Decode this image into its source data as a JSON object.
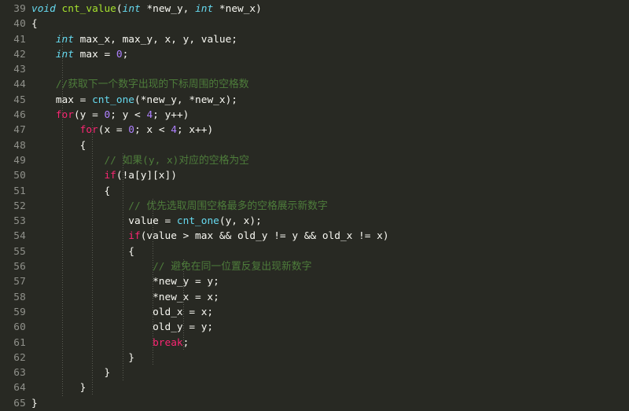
{
  "editor": {
    "theme_name": "monokai",
    "language": "c",
    "colors": {
      "background": "#282923",
      "gutter_background": "#282923",
      "line_number": "#8f908a",
      "foreground": "#f8f8f2",
      "keyword": "#f92672",
      "type": "#66d9ef",
      "function": "#a6e22e",
      "function_call": "#66d9ef",
      "number": "#ae81ff",
      "comment": "#4e7d3b",
      "indent_guide": "#595b52"
    },
    "first_line_number": 39,
    "last_line_number": 65,
    "indent_guide_columns": [
      4,
      8,
      12,
      16,
      20,
      24
    ]
  },
  "lines": [
    {
      "number": "39",
      "indent": 0,
      "tokens": [
        {
          "text": "void",
          "type": "type"
        },
        {
          "text": " ",
          "type": "plain"
        },
        {
          "text": "cnt_value",
          "type": "func"
        },
        {
          "text": "(",
          "type": "punc"
        },
        {
          "text": "int",
          "type": "type"
        },
        {
          "text": " *new_y, ",
          "type": "plain"
        },
        {
          "text": "int",
          "type": "type"
        },
        {
          "text": " *new_x)",
          "type": "plain"
        }
      ]
    },
    {
      "number": "40",
      "indent": 0,
      "tokens": [
        {
          "text": "{",
          "type": "punc"
        }
      ]
    },
    {
      "number": "41",
      "indent": 4,
      "tokens": [
        {
          "text": "int",
          "type": "type"
        },
        {
          "text": " max_x, max_y, x, y, value;",
          "type": "plain"
        }
      ]
    },
    {
      "number": "42",
      "indent": 4,
      "tokens": [
        {
          "text": "int",
          "type": "type"
        },
        {
          "text": " max = ",
          "type": "plain"
        },
        {
          "text": "0",
          "type": "number"
        },
        {
          "text": ";",
          "type": "plain"
        }
      ]
    },
    {
      "number": "43",
      "indent": 0,
      "tokens": []
    },
    {
      "number": "44",
      "indent": 4,
      "tokens": [
        {
          "text": "//获取下一个数字出现的下标周围的空格数",
          "type": "comment"
        }
      ]
    },
    {
      "number": "45",
      "indent": 4,
      "tokens": [
        {
          "text": "max = ",
          "type": "plain"
        },
        {
          "text": "cnt_one",
          "type": "call"
        },
        {
          "text": "(*new_y, *new_x);",
          "type": "plain"
        }
      ]
    },
    {
      "number": "46",
      "indent": 4,
      "tokens": [
        {
          "text": "for",
          "type": "keyword"
        },
        {
          "text": "(y = ",
          "type": "plain"
        },
        {
          "text": "0",
          "type": "number"
        },
        {
          "text": "; y < ",
          "type": "plain"
        },
        {
          "text": "4",
          "type": "number"
        },
        {
          "text": "; y++)",
          "type": "plain"
        }
      ]
    },
    {
      "number": "47",
      "indent": 8,
      "tokens": [
        {
          "text": "for",
          "type": "keyword"
        },
        {
          "text": "(x = ",
          "type": "plain"
        },
        {
          "text": "0",
          "type": "number"
        },
        {
          "text": "; x < ",
          "type": "plain"
        },
        {
          "text": "4",
          "type": "number"
        },
        {
          "text": "; x++)",
          "type": "plain"
        }
      ]
    },
    {
      "number": "48",
      "indent": 8,
      "tokens": [
        {
          "text": "{",
          "type": "punc"
        }
      ]
    },
    {
      "number": "49",
      "indent": 12,
      "tokens": [
        {
          "text": "// 如果(y, x)对应的空格为空",
          "type": "comment"
        }
      ]
    },
    {
      "number": "50",
      "indent": 12,
      "tokens": [
        {
          "text": "if",
          "type": "keyword"
        },
        {
          "text": "(!a[y][x])",
          "type": "plain"
        }
      ]
    },
    {
      "number": "51",
      "indent": 12,
      "tokens": [
        {
          "text": "{",
          "type": "punc"
        }
      ]
    },
    {
      "number": "52",
      "indent": 16,
      "tokens": [
        {
          "text": "// 优先选取周围空格最多的空格展示新数字",
          "type": "comment"
        }
      ]
    },
    {
      "number": "53",
      "indent": 16,
      "tokens": [
        {
          "text": "value = ",
          "type": "plain"
        },
        {
          "text": "cnt_one",
          "type": "call"
        },
        {
          "text": "(y, x);",
          "type": "plain"
        }
      ]
    },
    {
      "number": "54",
      "indent": 16,
      "tokens": [
        {
          "text": "if",
          "type": "keyword"
        },
        {
          "text": "(value > max && old_y != y && old_x != x)",
          "type": "plain"
        }
      ]
    },
    {
      "number": "55",
      "indent": 16,
      "tokens": [
        {
          "text": "{",
          "type": "punc"
        }
      ]
    },
    {
      "number": "56",
      "indent": 20,
      "tokens": [
        {
          "text": "// 避免在同一位置反复出现新数字",
          "type": "comment"
        }
      ]
    },
    {
      "number": "57",
      "indent": 20,
      "tokens": [
        {
          "text": "*new_y = y;",
          "type": "plain"
        }
      ]
    },
    {
      "number": "58",
      "indent": 20,
      "tokens": [
        {
          "text": "*new_x = x;",
          "type": "plain"
        }
      ]
    },
    {
      "number": "59",
      "indent": 20,
      "tokens": [
        {
          "text": "old_x = x;",
          "type": "plain"
        }
      ]
    },
    {
      "number": "60",
      "indent": 20,
      "tokens": [
        {
          "text": "old_y = y;",
          "type": "plain"
        }
      ]
    },
    {
      "number": "61",
      "indent": 20,
      "tokens": [
        {
          "text": "break",
          "type": "keyword"
        },
        {
          "text": ";",
          "type": "plain"
        }
      ]
    },
    {
      "number": "62",
      "indent": 16,
      "tokens": [
        {
          "text": "}",
          "type": "punc"
        }
      ]
    },
    {
      "number": "63",
      "indent": 12,
      "tokens": [
        {
          "text": "}",
          "type": "punc"
        }
      ]
    },
    {
      "number": "64",
      "indent": 8,
      "tokens": [
        {
          "text": "}",
          "type": "punc"
        }
      ]
    },
    {
      "number": "65",
      "indent": 0,
      "tokens": [
        {
          "text": "}",
          "type": "punc"
        }
      ]
    }
  ]
}
